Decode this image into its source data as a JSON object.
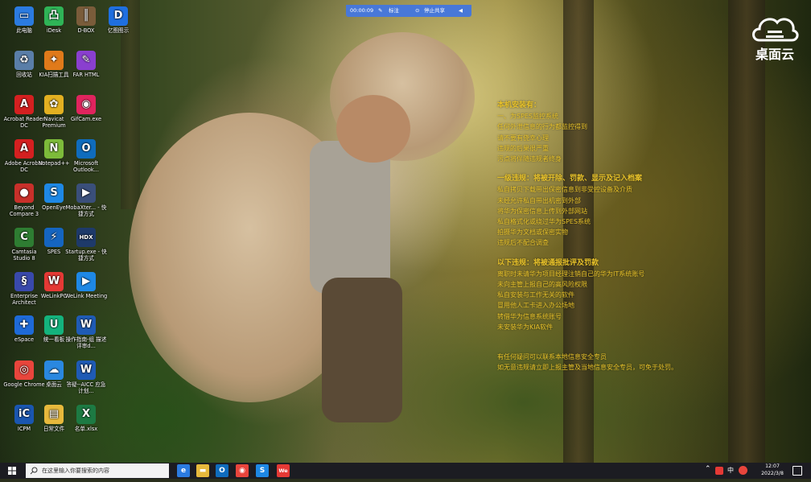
{
  "desktop_icons": [
    {
      "label": "此电脑",
      "icon": "computer-icon",
      "color": "#2b7be0",
      "glyph": "▭"
    },
    {
      "label": "iDesk",
      "icon": "idesk-icon",
      "color": "#2fb457",
      "glyph": "凸"
    },
    {
      "label": "D-BOX",
      "icon": "dbox-icon",
      "color": "#7a5c3a",
      "glyph": "║"
    },
    {
      "label": "亿图图示",
      "icon": "edraw-icon",
      "color": "#1f6fe0",
      "glyph": "D"
    },
    {
      "label": "回收站",
      "icon": "recycle-bin-icon",
      "color": "#5a7ea8",
      "glyph": "♻"
    },
    {
      "label": "KIA扫描工具",
      "icon": "kia-scan-icon",
      "color": "#e07a1a",
      "glyph": "✦"
    },
    {
      "label": "FAR HTML",
      "icon": "far-html-icon",
      "color": "#8a3fcf",
      "glyph": "✎"
    },
    {
      "label": "Acrobat Reader DC",
      "icon": "acrobat-reader-icon",
      "color": "#d42020",
      "glyph": "A"
    },
    {
      "label": "Navicat Premium",
      "icon": "navicat-icon",
      "color": "#e3b021",
      "glyph": "✿"
    },
    {
      "label": "GifCam.exe",
      "icon": "gifcam-icon",
      "color": "#e0245e",
      "glyph": "◉"
    },
    {
      "label": "Adobe Acrobat DC",
      "icon": "acrobat-dc-icon",
      "color": "#d42020",
      "glyph": "A"
    },
    {
      "label": "Notepad++",
      "icon": "notepad-plus-icon",
      "color": "#7dbb3a",
      "glyph": "N"
    },
    {
      "label": "Microsoft Outlook...",
      "icon": "outlook-icon",
      "color": "#0f6cbd",
      "glyph": "O"
    },
    {
      "label": "Beyond Compare 3",
      "icon": "beyond-compare-icon",
      "color": "#c8302a",
      "glyph": "●"
    },
    {
      "label": "OpenEye",
      "icon": "openeye-icon",
      "color": "#1e88e5",
      "glyph": "S"
    },
    {
      "label": "MobaXter... - 快捷方式",
      "icon": "mobaxterm-icon",
      "color": "#3a4f7a",
      "glyph": "▶"
    },
    {
      "label": "Camtasia Studio 8",
      "icon": "camtasia-icon",
      "color": "#2e7d32",
      "glyph": "C"
    },
    {
      "label": "SPES",
      "icon": "spes-icon",
      "color": "#1565c0",
      "glyph": "⚡"
    },
    {
      "label": "Startup.exe - 快捷方式",
      "icon": "startup-hdx-icon",
      "color": "#1e3a6a",
      "glyph": "HDX"
    },
    {
      "label": "Enterprise Architect",
      "icon": "enterprise-architect-icon",
      "color": "#3949ab",
      "glyph": "§"
    },
    {
      "label": "WeLinkPC",
      "icon": "welink-icon",
      "color": "#e53935",
      "glyph": "W"
    },
    {
      "label": "WeLink Meeting",
      "icon": "welink-meeting-icon",
      "color": "#1e88e5",
      "glyph": "▶"
    },
    {
      "label": "eSpace",
      "icon": "espace-icon",
      "color": "#1e6ad8",
      "glyph": "✚"
    },
    {
      "label": "统一看板",
      "icon": "dashboard-icon",
      "color": "#14b37d",
      "glyph": "U"
    },
    {
      "label": "操作指南-组 描述评审d...",
      "icon": "word-doc-icon",
      "color": "#1f5bb5",
      "glyph": "W"
    },
    {
      "label": "Google Chrome",
      "icon": "chrome-icon",
      "color": "#e8453c",
      "glyph": "◎"
    },
    {
      "label": "桌面云",
      "icon": "desktop-cloud-icon",
      "color": "#2a88e0",
      "glyph": "☁"
    },
    {
      "label": "答疑--AICC 应急计划...",
      "icon": "word-doc-icon",
      "color": "#1f5bb5",
      "glyph": "W"
    },
    {
      "label": "ICPM",
      "icon": "icpm-icon",
      "color": "#1a56b0",
      "glyph": "iC"
    },
    {
      "label": "日常文件",
      "icon": "folder-icon",
      "color": "#e7b93c",
      "glyph": "▤"
    },
    {
      "label": "名单.xlsx",
      "icon": "excel-icon",
      "color": "#1d7a43",
      "glyph": "X"
    }
  ],
  "notice": {
    "lines": [
      {
        "text": "本机安装有：",
        "style": "h"
      },
      {
        "text": "一、为SPES监控系统",
        "style": "n"
      },
      {
        "text": "任何外泄信息的行为都监控得到",
        "style": "n"
      },
      {
        "text": "请不要有侥幸心理",
        "style": "n"
      },
      {
        "text": "违规的后果很严重",
        "style": "n"
      },
      {
        "text": "污点将伴随违规者终身",
        "style": "n"
      },
      {
        "text": "",
        "style": "gap"
      },
      {
        "text": "一级违规：将被开除、罚款、显示及记入档案",
        "style": "h"
      },
      {
        "text": "私自拷贝下载带出保密信息到非受控设备及介质",
        "style": "n"
      },
      {
        "text": "未经允许私自带出机密到外部",
        "style": "n"
      },
      {
        "text": "将华为保密信息上传到外部网站",
        "style": "n"
      },
      {
        "text": "私自格式化或绕过华为SPES系统",
        "style": "n"
      },
      {
        "text": "拍摄华为文档或保密实物",
        "style": "n"
      },
      {
        "text": "违规后不配合调查",
        "style": "n"
      },
      {
        "text": "",
        "style": "gap"
      },
      {
        "text": "以下违规：将被通报批评及罚款",
        "style": "h"
      },
      {
        "text": "离职时未请华为项目经理注销自己的华为IT系统账号",
        "style": "n"
      },
      {
        "text": "未向主管上报自己的高风险权限",
        "style": "n"
      },
      {
        "text": "私自安装与工作无关的软件",
        "style": "n"
      },
      {
        "text": "冒用他人工卡进入办公场地",
        "style": "n"
      },
      {
        "text": "转借华为信息系统账号",
        "style": "n"
      },
      {
        "text": "未安装华为KIA软件",
        "style": "n"
      },
      {
        "text": "",
        "style": "gap2"
      },
      {
        "text": "有任何疑问可以联系本地信息安全专员",
        "style": "n"
      },
      {
        "text": "如无意违规请立即上报主管及当地信息安全专员，可免于处罚。",
        "style": "n"
      }
    ]
  },
  "cloud_logo": {
    "text": "桌面云"
  },
  "recording_bar": {
    "time": "00:00:09",
    "annotate": "标注",
    "stop_share": "停止共享"
  },
  "taskbar": {
    "search_placeholder": "在这里输入你要搜索的内容",
    "pinned": [
      {
        "name": "edge-icon",
        "glyph": "e",
        "color": "#2b7be0"
      },
      {
        "name": "file-explorer-icon",
        "glyph": "▬",
        "color": "#e7b93c"
      },
      {
        "name": "outlook-icon",
        "glyph": "O",
        "color": "#0f6cbd"
      },
      {
        "name": "chrome-icon",
        "glyph": "◉",
        "color": "#e8453c"
      },
      {
        "name": "openeye-icon",
        "glyph": "S",
        "color": "#1e88e5"
      },
      {
        "name": "welink-icon",
        "glyph": "We",
        "color": "#e53935"
      }
    ],
    "tray": {
      "ime": "中",
      "time": "12:07",
      "date": "2022/3/8"
    }
  }
}
